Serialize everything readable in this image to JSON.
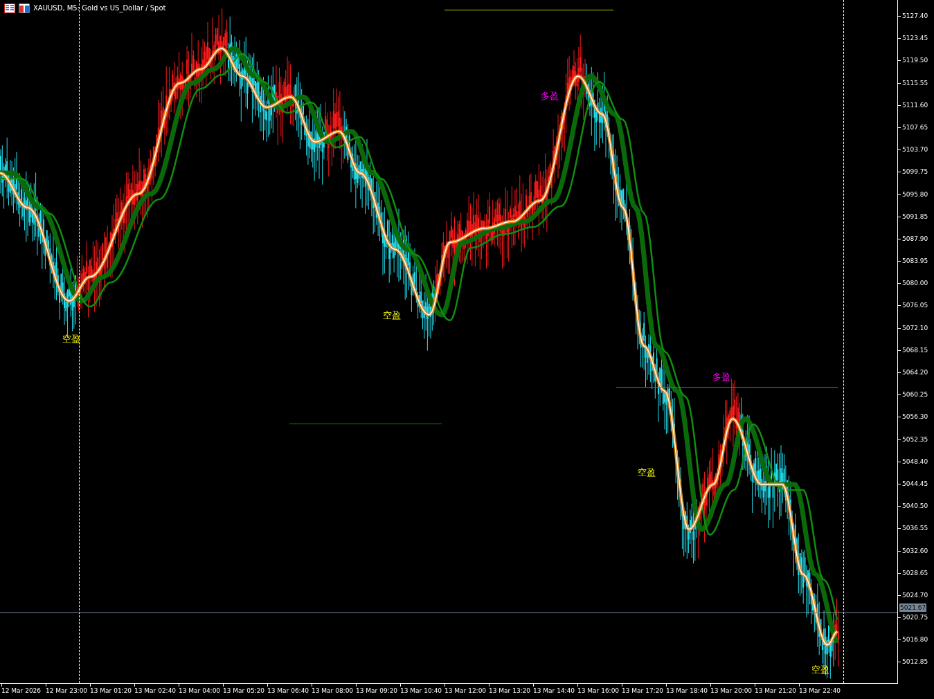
{
  "chart_header": {
    "title": "XAUUSD, M5: Gold vs US_Dollar / Spot"
  },
  "price_axis": {
    "ticks": [
      "5127.40",
      "5123.45",
      "5119.50",
      "5115.55",
      "5111.60",
      "5107.65",
      "5103.70",
      "5099.75",
      "5095.80",
      "5091.85",
      "5087.90",
      "5083.95",
      "5080.00",
      "5076.05",
      "5072.10",
      "5068.15",
      "5064.20",
      "5060.25",
      "5056.30",
      "5052.35",
      "5048.40",
      "5044.45",
      "5040.50",
      "5036.55",
      "5032.60",
      "5028.65",
      "5024.70",
      "5020.75",
      "5016.80",
      "5012.85"
    ],
    "current_price": "5021.67"
  },
  "time_axis": {
    "labels": [
      "12 Mar 2026",
      "12 Mar 23:00",
      "13 Mar 01:20",
      "13 Mar 02:40",
      "13 Mar 04:00",
      "13 Mar 05:20",
      "13 Mar 06:40",
      "13 Mar 08:00",
      "13 Mar 09:20",
      "13 Mar 10:40",
      "13 Mar 12:00",
      "13 Mar 13:20",
      "13 Mar 14:40",
      "13 Mar 16:00",
      "13 Mar 17:20",
      "13 Mar 18:40",
      "13 Mar 20:00",
      "13 Mar 21:20",
      "13 Mar 22:40"
    ]
  },
  "signals": [
    {
      "text": "空盈",
      "kind": "short"
    },
    {
      "text": "空盈",
      "kind": "short"
    },
    {
      "text": "多盈",
      "kind": "long"
    },
    {
      "text": "空盈",
      "kind": "short"
    },
    {
      "text": "多盈",
      "kind": "long"
    },
    {
      "text": "空盈",
      "kind": "short"
    }
  ]
}
